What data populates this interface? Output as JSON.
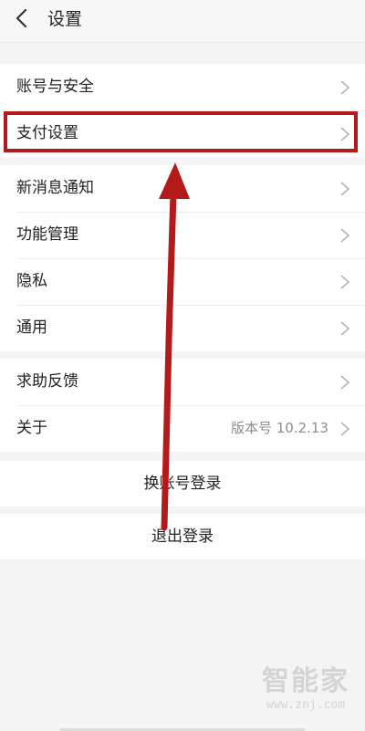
{
  "header": {
    "title": "设置",
    "back_icon": "chevron-left-icon"
  },
  "groups": [
    {
      "rows": [
        {
          "label": "账号与安全"
        },
        {
          "label": "支付设置"
        }
      ]
    },
    {
      "rows": [
        {
          "label": "新消息通知"
        },
        {
          "label": "功能管理"
        },
        {
          "label": "隐私"
        },
        {
          "label": "通用"
        }
      ]
    },
    {
      "rows": [
        {
          "label": "求助反馈"
        },
        {
          "label": "关于",
          "value": "版本号 10.2.13"
        }
      ]
    }
  ],
  "buttons": {
    "switch_account": "换账号登录",
    "logout": "退出登录"
  },
  "annotation": {
    "color": "#b31b1b"
  },
  "watermark": {
    "logo": "智能家",
    "url": "www.znj.com"
  }
}
